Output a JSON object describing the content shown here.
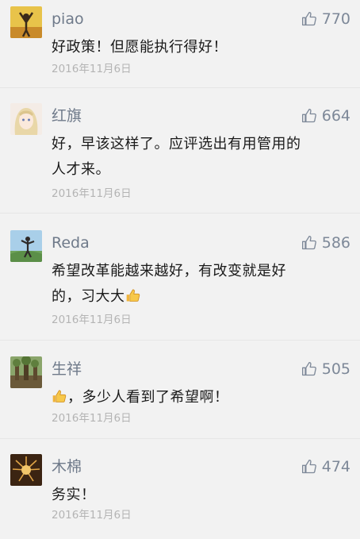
{
  "comments": [
    {
      "name": "piao",
      "likes": "770",
      "text": "好政策！但愿能执行得好！",
      "date": "2016年11月6日"
    },
    {
      "name": "红旗",
      "likes": "664",
      "text_line1": "好，早该这样了。应评选出有用管用的",
      "text_line2": "人才来。",
      "date": "2016年11月6日"
    },
    {
      "name": "Reda",
      "likes": "586",
      "text_line1": "希望改革能越来越好，有改变就是好",
      "text_line2": "的，习大大",
      "emoji": "thumbs-up-emoji",
      "date": "2016年11月6日"
    },
    {
      "name": "生祥",
      "likes": "505",
      "emoji": "thumbs-up-emoji",
      "text": "，多少人看到了希望啊！",
      "date": "2016年11月6日"
    },
    {
      "name": "木棉",
      "likes": "474",
      "text": "务实！",
      "date": "2016年11月6日"
    }
  ],
  "icons": {
    "like": "thumbs-up-outline-icon"
  },
  "colors": {
    "name": "#6f7a8a",
    "likes": "#7d8898",
    "date": "#b4b4b4",
    "text": "#1a1a1a",
    "background": "#f2f2f2"
  }
}
